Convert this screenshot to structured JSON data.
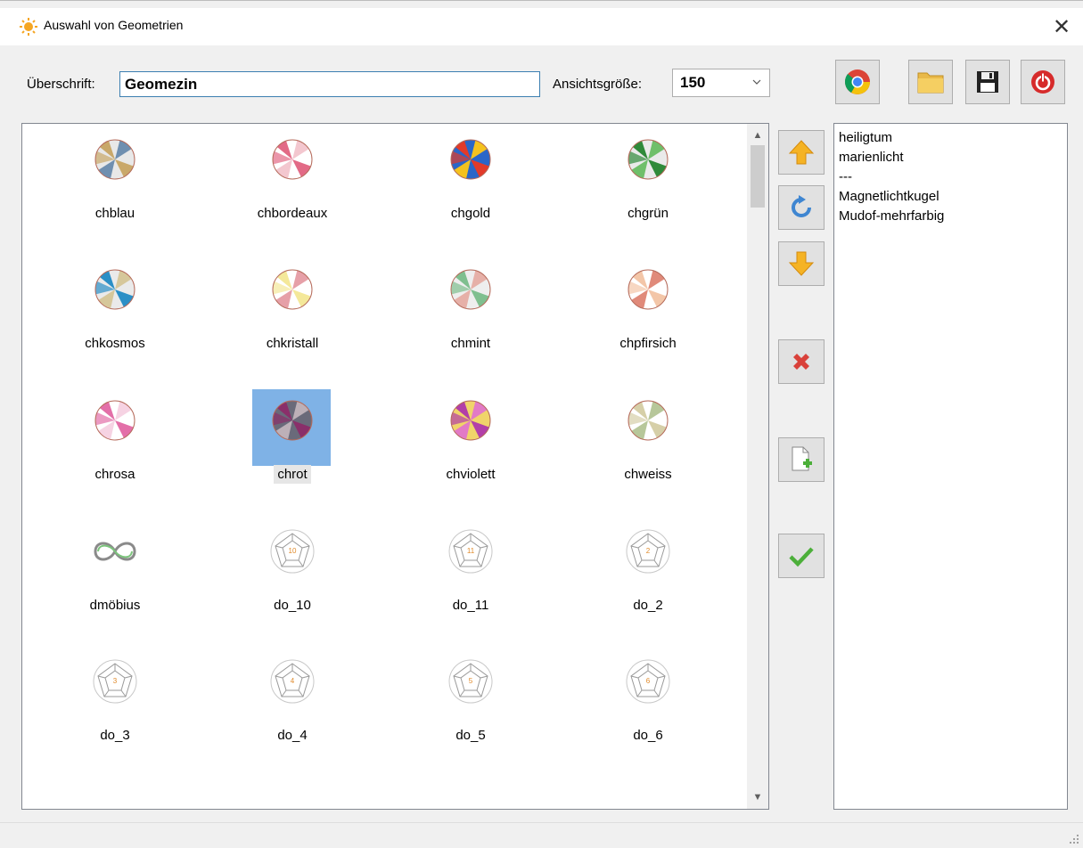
{
  "window": {
    "title": "Auswahl von Geometrien",
    "close_glyph": "✕"
  },
  "header": {
    "heading_label": "Überschrift:",
    "heading_value": "Geomezin",
    "view_size_label": "Ansichtsgröße:",
    "view_size_value": "150"
  },
  "toolbar": {
    "buttons": [
      "chrome-icon",
      "folder-icon",
      "save-icon",
      "power-icon"
    ]
  },
  "gallery": {
    "items": [
      {
        "label": "chblau",
        "icon": "ball-icon",
        "colors": [
          "#c9a86a",
          "#6f8fb0",
          "#e8e8e8"
        ]
      },
      {
        "label": "chbordeaux",
        "icon": "ball-icon",
        "colors": [
          "#e26a86",
          "#f3c7cf",
          "#ffffff"
        ]
      },
      {
        "label": "chgold",
        "icon": "ball-icon",
        "colors": [
          "#e23a2a",
          "#f4c21e",
          "#2a66c8"
        ]
      },
      {
        "label": "chgrün",
        "icon": "ball-icon",
        "colors": [
          "#2f8a3a",
          "#6fbf6a",
          "#eaeaea"
        ]
      },
      {
        "label": "chkosmos",
        "icon": "ball-icon",
        "colors": [
          "#2b8fc6",
          "#d6c79a",
          "#eaeaea"
        ]
      },
      {
        "label": "chkristall",
        "icon": "ball-icon",
        "colors": [
          "#f4e89a",
          "#e6a0a8",
          "#ffffff"
        ]
      },
      {
        "label": "chmint",
        "icon": "ball-icon",
        "colors": [
          "#7fbf8f",
          "#e6b0a8",
          "#eeeeee"
        ]
      },
      {
        "label": "chpfirsich",
        "icon": "ball-icon",
        "colors": [
          "#f3c6a8",
          "#e08a7a",
          "#ffffff"
        ]
      },
      {
        "label": "chrosa",
        "icon": "ball-icon",
        "colors": [
          "#e36fa8",
          "#f6d3e3",
          "#ffffff"
        ]
      },
      {
        "label": "chrot",
        "icon": "ball-icon",
        "colors": [
          "#8a2f6a",
          "#bdb0b8",
          "#6a6a7a"
        ],
        "selected": true
      },
      {
        "label": "chviolett",
        "icon": "ball-icon",
        "colors": [
          "#b23fa8",
          "#e27ac6",
          "#f0d46a"
        ]
      },
      {
        "label": "chweiss",
        "icon": "ball-icon",
        "colors": [
          "#d6cfa8",
          "#b7c79a",
          "#ffffff"
        ]
      },
      {
        "label": "dmöbius",
        "icon": "mobius-icon"
      },
      {
        "label": "do_10",
        "icon": "dodecahedron-icon",
        "num": "10"
      },
      {
        "label": "do_11",
        "icon": "dodecahedron-icon",
        "num": "11"
      },
      {
        "label": "do_2",
        "icon": "dodecahedron-icon",
        "num": "2"
      },
      {
        "label": "do_3",
        "icon": "dodecahedron-icon",
        "num": "3"
      },
      {
        "label": "do_4",
        "icon": "dodecahedron-icon",
        "num": "4"
      },
      {
        "label": "do_5",
        "icon": "dodecahedron-icon",
        "num": "5"
      },
      {
        "label": "do_6",
        "icon": "dodecahedron-icon",
        "num": "6"
      }
    ]
  },
  "side_buttons": [
    "move-up-icon",
    "refresh-icon",
    "move-down-icon",
    "delete-icon",
    "new-file-icon",
    "confirm-icon"
  ],
  "list": {
    "items": [
      "heiligtum",
      "marienlicht",
      "---",
      "Magnetlichtkugel",
      "Mudof-mehrfarbig"
    ]
  },
  "colors": {
    "accent": "#3c7fb1",
    "selection": "#7fb2e6",
    "arrow_orange": "#f5b324",
    "delete_red": "#d9413a",
    "ok_green": "#4caf3a"
  }
}
